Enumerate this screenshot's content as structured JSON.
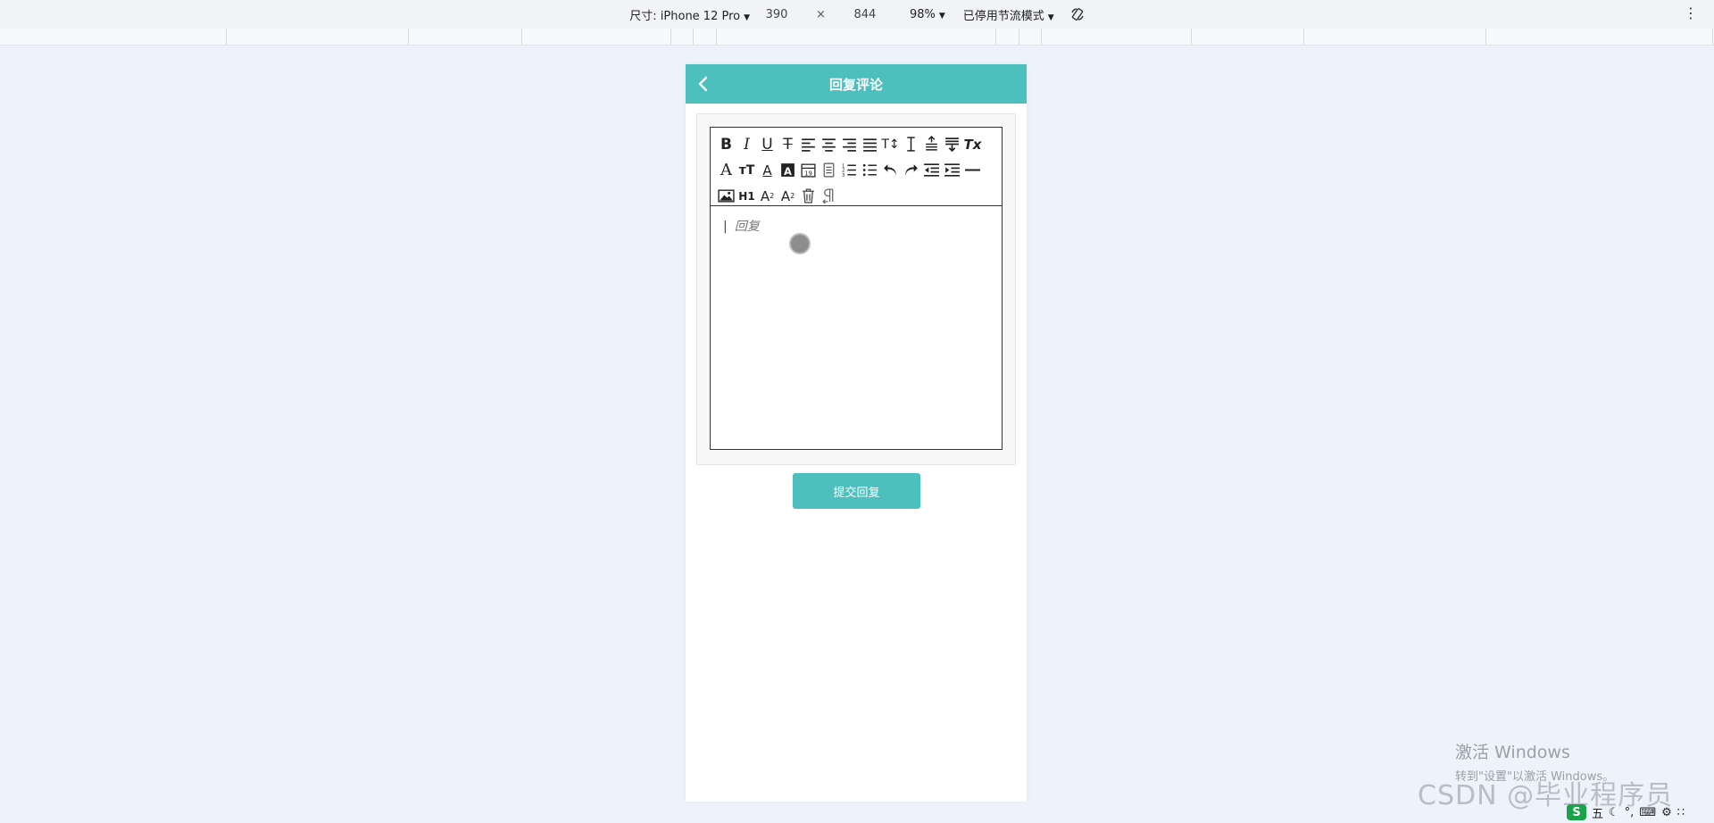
{
  "devtools": {
    "device_label": "尺寸: iPhone 12 Pro",
    "width": "390",
    "times": "×",
    "height": "844",
    "zoom": "98%",
    "throttle": "已停用节流模式",
    "more": "⋮"
  },
  "header": {
    "title": "回复评论",
    "back_icon": "chevron-left-icon"
  },
  "editor": {
    "toolbar_rows": [
      [
        "B",
        "I",
        "U",
        "S",
        "≡L",
        "≡C",
        "≡R",
        "≡J",
        "TI",
        "LH",
        "SP",
        "VA",
        "Tx"
      ],
      [
        "A",
        "tT",
        "A_",
        "A■",
        "CAL",
        "DOC",
        "OL",
        "UL",
        "UNDO",
        "REDO",
        "OUT",
        "IN",
        "HR"
      ],
      [
        "IMG",
        "H1",
        "SUB",
        "SUP",
        "DEL",
        "PARA"
      ]
    ],
    "placeholder": "回复"
  },
  "submit_label": "提交回复",
  "watermark": {
    "line1": "激活 Windows",
    "line2": "转到\"设置\"以激活 Windows。",
    "csdn": "CSDN @毕业程序员"
  },
  "tray": {
    "ime": "五"
  },
  "colors": {
    "accent": "#4dbfbd",
    "page_bg": "#eef2fa"
  }
}
